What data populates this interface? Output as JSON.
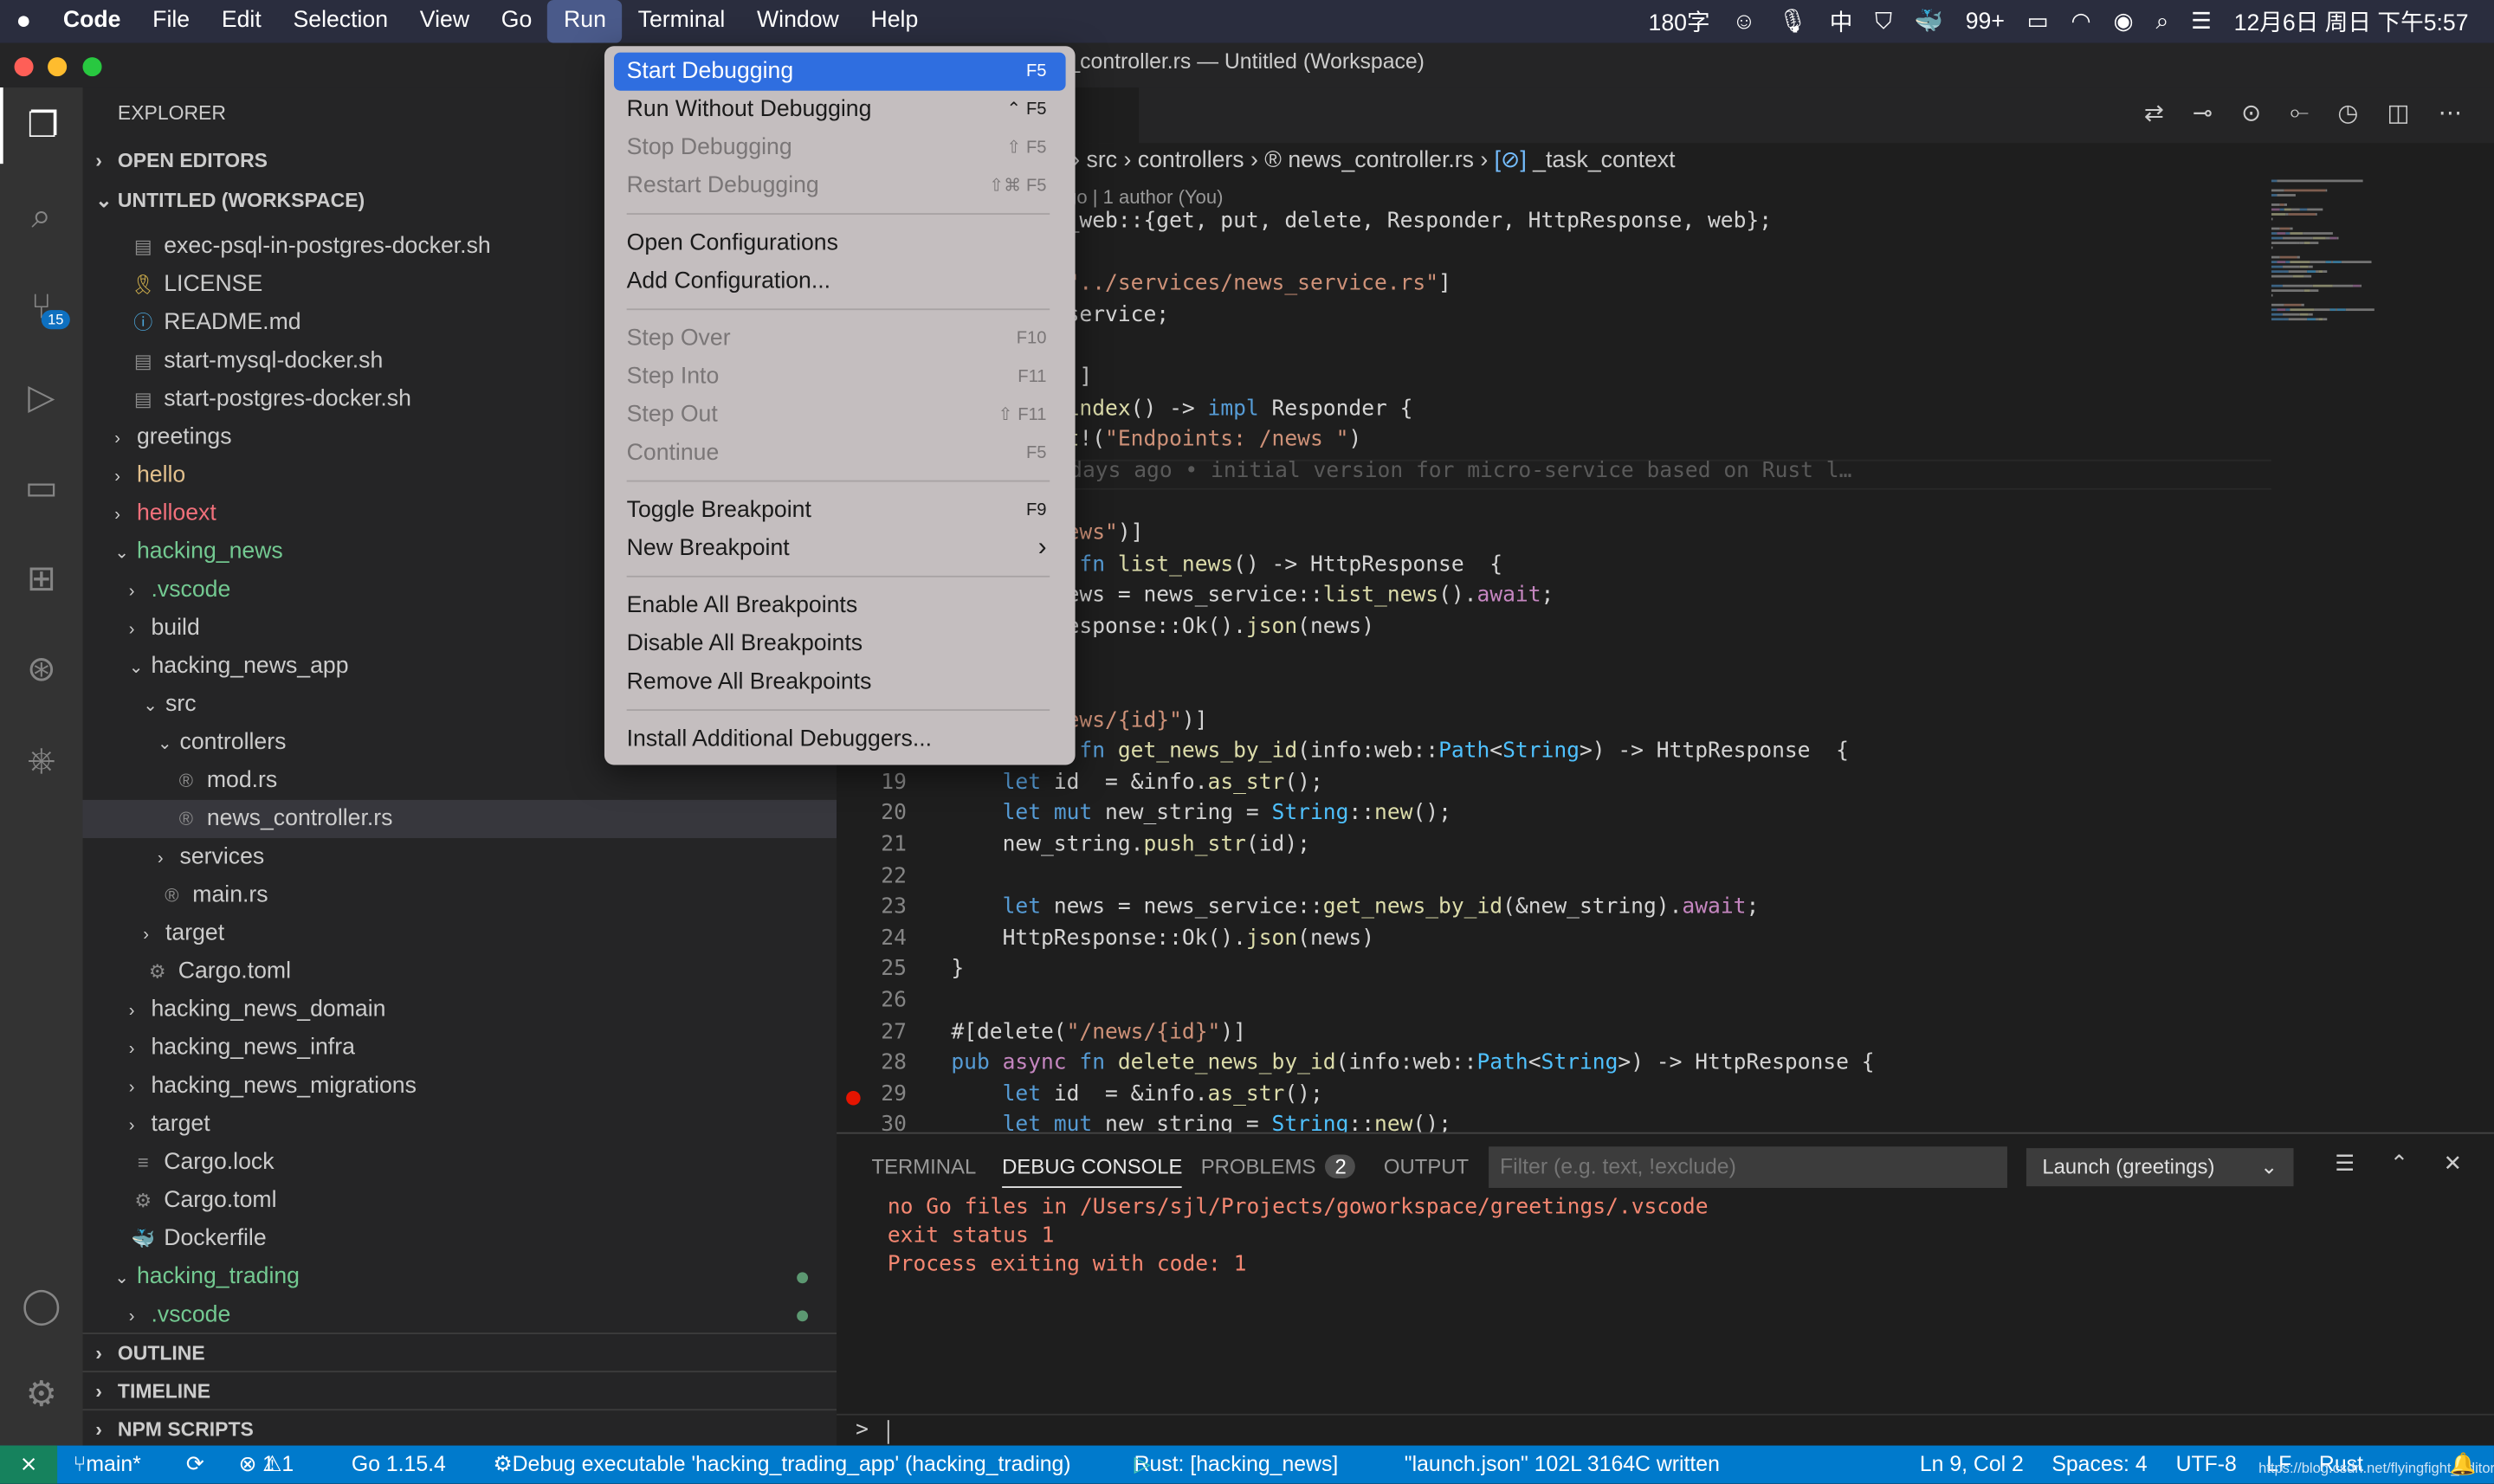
{
  "macbar": {
    "apple": "",
    "app": "Code",
    "menus": [
      "File",
      "Edit",
      "Selection",
      "View",
      "Go",
      "Run",
      "Terminal",
      "Window",
      "Help"
    ],
    "active": "Run",
    "status_items": [
      "180字",
      "☺",
      "🎙",
      "中",
      "99+"
    ],
    "datetime": "12月6日 周日 下午5:57"
  },
  "window": {
    "title": "news_controller.rs — Untitled (Workspace)"
  },
  "activity": {
    "items": [
      {
        "icon": "files-icon"
      },
      {
        "icon": "search-icon"
      },
      {
        "icon": "source-control-icon",
        "badge": "15"
      },
      {
        "icon": "run-debug-icon"
      },
      {
        "icon": "remote-explorer-icon"
      },
      {
        "icon": "extensions-icon"
      },
      {
        "icon": "git-graph-icon"
      },
      {
        "icon": "kubernetes-icon"
      }
    ],
    "bottom": [
      {
        "icon": "account-icon"
      },
      {
        "icon": "gear-icon"
      }
    ]
  },
  "sidebar": {
    "title": "EXPLORER",
    "open_editors": "OPEN EDITORS",
    "workspace": "UNTITLED (WORKSPACE)",
    "outline": "OUTLINE",
    "timeline": "TIMELINE",
    "npm": "NPM SCRIPTS",
    "tree": [
      {
        "label": "exec-psql-in-postgres-docker.sh",
        "depth": 1,
        "type": "file",
        "icon": "▤",
        "iconColor": "#8a8a8a"
      },
      {
        "label": "LICENSE",
        "depth": 1,
        "type": "file",
        "icon": "🎗",
        "iconColor": "#d4b24c"
      },
      {
        "label": "README.md",
        "depth": 1,
        "type": "file",
        "icon": "ⓘ",
        "iconColor": "#4ba5d9"
      },
      {
        "label": "start-mysql-docker.sh",
        "depth": 1,
        "type": "file",
        "icon": "▤",
        "iconColor": "#8a8a8a"
      },
      {
        "label": "start-postgres-docker.sh",
        "depth": 1,
        "type": "file",
        "icon": "▤",
        "iconColor": "#8a8a8a"
      },
      {
        "label": "greetings",
        "depth": 0,
        "type": "folder",
        "open": false
      },
      {
        "label": "hello",
        "depth": 0,
        "type": "folder",
        "open": false,
        "color": "#e2c08d"
      },
      {
        "label": "helloext",
        "depth": 0,
        "type": "folder",
        "open": false,
        "color": "#f1707b"
      },
      {
        "label": "hacking_news",
        "depth": 0,
        "type": "folder",
        "open": true,
        "color": "#73c991"
      },
      {
        "label": ".vscode",
        "depth": 1,
        "type": "folder",
        "open": false,
        "color": "#73c991"
      },
      {
        "label": "build",
        "depth": 1,
        "type": "folder",
        "open": false
      },
      {
        "label": "hacking_news_app",
        "depth": 1,
        "type": "folder",
        "open": true
      },
      {
        "label": "src",
        "depth": 2,
        "type": "folder",
        "open": true
      },
      {
        "label": "controllers",
        "depth": 3,
        "type": "folder",
        "open": true
      },
      {
        "label": "mod.rs",
        "depth": 4,
        "type": "file",
        "icon": "®",
        "iconColor": "#8a8a8a"
      },
      {
        "label": "news_controller.rs",
        "depth": 4,
        "type": "file",
        "icon": "®",
        "iconColor": "#8a8a8a",
        "selected": true
      },
      {
        "label": "services",
        "depth": 3,
        "type": "folder",
        "open": false
      },
      {
        "label": "main.rs",
        "depth": 3,
        "type": "file",
        "icon": "®",
        "iconColor": "#8a8a8a"
      },
      {
        "label": "target",
        "depth": 2,
        "type": "folder",
        "open": false
      },
      {
        "label": "Cargo.toml",
        "depth": 2,
        "type": "file",
        "icon": "⚙",
        "iconColor": "#8a8a8a"
      },
      {
        "label": "hacking_news_domain",
        "depth": 1,
        "type": "folder",
        "open": false
      },
      {
        "label": "hacking_news_infra",
        "depth": 1,
        "type": "folder",
        "open": false
      },
      {
        "label": "hacking_news_migrations",
        "depth": 1,
        "type": "folder",
        "open": false
      },
      {
        "label": "target",
        "depth": 1,
        "type": "folder",
        "open": false
      },
      {
        "label": "Cargo.lock",
        "depth": 1,
        "type": "file",
        "icon": "≡",
        "iconColor": "#8a8a8a"
      },
      {
        "label": "Cargo.toml",
        "depth": 1,
        "type": "file",
        "icon": "⚙",
        "iconColor": "#8a8a8a"
      },
      {
        "label": "Dockerfile",
        "depth": 1,
        "type": "file",
        "icon": "🐳",
        "iconColor": "#3a94d6"
      },
      {
        "label": "hacking_trading",
        "depth": 0,
        "type": "folder",
        "open": true,
        "color": "#73c991",
        "dot": true
      },
      {
        "label": ".vscode",
        "depth": 1,
        "type": "folder",
        "open": false,
        "color": "#73c991",
        "dot": true
      }
    ]
  },
  "editor": {
    "breadcrumb": [
      "hacking_news",
      "hacking_news_app",
      "src",
      "controllers",
      "news_controller.rs",
      "_task_context"
    ],
    "blame_header": "You, 6 days ago | 1 author (You)",
    "inline_blame": "You, 6 days ago • initial version for micro-service based on Rust l…",
    "current_line": 9,
    "breakpoint_line": 29,
    "lines": [
      [
        [
          "use ",
          "kw"
        ],
        [
          "actix_web::{get, put, delete, Responder, HttpResponse, web};",
          "tx"
        ]
      ],
      [],
      [
        [
          "#[path = ",
          "tx"
        ],
        [
          "\"../services/news_service.rs\"",
          "st"
        ],
        [
          "]",
          "tx"
        ]
      ],
      [
        [
          "mod ",
          "kw"
        ],
        [
          "news_service;",
          "tx"
        ]
      ],
      [],
      [
        [
          "#[get(",
          "tx"
        ],
        [
          "\"/\"",
          "st"
        ],
        [
          ")]",
          "tx"
        ]
      ],
      [
        [
          "async ",
          "aw"
        ],
        [
          "fn ",
          "kw"
        ],
        [
          "index",
          "fn"
        ],
        [
          "() -> ",
          "tx"
        ],
        [
          "impl ",
          "kw"
        ],
        [
          "Responder {",
          "tx"
        ]
      ],
      [
        [
          "    format",
          "fn"
        ],
        [
          "!(",
          "tx"
        ],
        [
          "\"Endpoints: /news \"",
          "st"
        ],
        [
          ")",
          "tx"
        ]
      ],
      [
        [
          "}",
          "tx"
        ]
      ],
      [],
      [
        [
          "#[get(",
          "tx"
        ],
        [
          "\"/news\"",
          "st"
        ],
        [
          ")]",
          "tx"
        ]
      ],
      [
        [
          "pub ",
          "kw"
        ],
        [
          "async ",
          "aw"
        ],
        [
          "fn ",
          "kw"
        ],
        [
          "list_news",
          "fn"
        ],
        [
          "() -> HttpResponse  {",
          "tx"
        ]
      ],
      [
        [
          "    let ",
          "kw"
        ],
        [
          "news = news_service::",
          "tx"
        ],
        [
          "list_news",
          "fn"
        ],
        [
          "().",
          "tx"
        ],
        [
          "await",
          "aw"
        ],
        [
          ";",
          "tx"
        ]
      ],
      [
        [
          "    HttpResponse::",
          "tx"
        ],
        [
          "Ok",
          "tx"
        ],
        [
          "().",
          "tx"
        ],
        [
          "json",
          "fn"
        ],
        [
          "(news)",
          "tx"
        ]
      ],
      [
        [
          "}",
          "tx"
        ]
      ],
      [],
      [
        [
          "#[get(",
          "tx"
        ],
        [
          "\"/news/{id}\"",
          "st"
        ],
        [
          ")]",
          "tx"
        ]
      ],
      [
        [
          "pub ",
          "kw"
        ],
        [
          "async ",
          "aw"
        ],
        [
          "fn ",
          "kw"
        ],
        [
          "get_news_by_id",
          "fn"
        ],
        [
          "(info:web::",
          "tx"
        ],
        [
          "Path",
          "tyb"
        ],
        [
          "<",
          "tx"
        ],
        [
          "String",
          "tyb"
        ],
        [
          ">) -> HttpResponse  {",
          "tx"
        ]
      ],
      [
        [
          "    let ",
          "kw"
        ],
        [
          "id  = &info.",
          "tx"
        ],
        [
          "as_str",
          "fn"
        ],
        [
          "();",
          "tx"
        ]
      ],
      [
        [
          "    let ",
          "kw"
        ],
        [
          "mut ",
          "kw"
        ],
        [
          "new_string = ",
          "tx"
        ],
        [
          "String",
          "tyb"
        ],
        [
          "::",
          "tx"
        ],
        [
          "new",
          "fn"
        ],
        [
          "();",
          "tx"
        ]
      ],
      [
        [
          "    new_string.",
          "tx"
        ],
        [
          "push_str",
          "fn"
        ],
        [
          "(id);",
          "tx"
        ]
      ],
      [],
      [
        [
          "    let ",
          "kw"
        ],
        [
          "news = news_service::",
          "tx"
        ],
        [
          "get_news_by_id",
          "fn"
        ],
        [
          "(&new_string).",
          "tx"
        ],
        [
          "await",
          "aw"
        ],
        [
          ";",
          "tx"
        ]
      ],
      [
        [
          "    HttpResponse::Ok().",
          "tx"
        ],
        [
          "json",
          "fn"
        ],
        [
          "(news)",
          "tx"
        ]
      ],
      [
        [
          "}",
          "tx"
        ]
      ],
      [],
      [
        [
          "#[delete(",
          "tx"
        ],
        [
          "\"/news/{id}\"",
          "st"
        ],
        [
          ")]",
          "tx"
        ]
      ],
      [
        [
          "pub ",
          "kw"
        ],
        [
          "async ",
          "aw"
        ],
        [
          "fn ",
          "kw"
        ],
        [
          "delete_news_by_id",
          "fn"
        ],
        [
          "(info:web::",
          "tx"
        ],
        [
          "Path",
          "tyb"
        ],
        [
          "<",
          "tx"
        ],
        [
          "String",
          "tyb"
        ],
        [
          ">) -> HttpResponse {",
          "tx"
        ]
      ],
      [
        [
          "    let ",
          "kw"
        ],
        [
          "id  = &info.",
          "tx"
        ],
        [
          "as_str",
          "fn"
        ],
        [
          "();",
          "tx"
        ]
      ],
      [
        [
          "    let ",
          "kw"
        ],
        [
          "mut ",
          "kw"
        ],
        [
          "new_string = ",
          "tx"
        ],
        [
          "String",
          "tyb"
        ],
        [
          "::",
          "tx"
        ],
        [
          "new",
          "fn"
        ],
        [
          "();",
          "tx"
        ]
      ]
    ]
  },
  "run_menu": {
    "items": [
      {
        "label": "Start Debugging",
        "shortcut": "F5",
        "highlight": true
      },
      {
        "label": "Run Without Debugging",
        "shortcut": "⌃ F5"
      },
      {
        "label": "Stop Debugging",
        "shortcut": "⇧ F5",
        "disabled": true
      },
      {
        "label": "Restart Debugging",
        "shortcut": "⇧⌘ F5",
        "disabled": true
      },
      {
        "sep": true
      },
      {
        "label": "Open Configurations",
        "shortcut": ""
      },
      {
        "label": "Add Configuration...",
        "shortcut": ""
      },
      {
        "sep": true
      },
      {
        "label": "Step Over",
        "shortcut": "F10",
        "disabled": true
      },
      {
        "label": "Step Into",
        "shortcut": "F11",
        "disabled": true
      },
      {
        "label": "Step Out",
        "shortcut": "⇧ F11",
        "disabled": true
      },
      {
        "label": "Continue",
        "shortcut": "F5",
        "disabled": true
      },
      {
        "sep": true
      },
      {
        "label": "Toggle Breakpoint",
        "shortcut": "F9"
      },
      {
        "label": "New Breakpoint",
        "shortcut": "›"
      },
      {
        "sep": true
      },
      {
        "label": "Enable All Breakpoints",
        "shortcut": ""
      },
      {
        "label": "Disable All Breakpoints",
        "shortcut": ""
      },
      {
        "label": "Remove All Breakpoints",
        "shortcut": ""
      },
      {
        "sep": true
      },
      {
        "label": "Install Additional Debuggers...",
        "shortcut": ""
      }
    ]
  },
  "panel": {
    "tabs": [
      "TERMINAL",
      "DEBUG CONSOLE",
      "PROBLEMS",
      "OUTPUT"
    ],
    "active": "DEBUG CONSOLE",
    "problems_count": "2",
    "filter_placeholder": "Filter (e.g. text, !exclude)",
    "launch": "Launch (greetings)",
    "output": [
      "no Go files in /Users/sjl/Projects/goworkspace/greetings/.vscode",
      "exit status 1",
      "Process exiting with code: 1"
    ],
    "prompt": ">"
  },
  "statusbar": {
    "remote": "⨯",
    "branch": "main*",
    "errors": "1",
    "warnings": "1",
    "go": "Go 1.15.4",
    "debug": "Debug executable 'hacking_trading_app' (hacking_trading)",
    "rust": "Rust: [hacking_news]",
    "message": "\"launch.json\" 102L 3164C written",
    "position": "Ln 9, Col 2",
    "spaces": "Spaces: 4",
    "encoding": "UTF-8",
    "eol": "LF",
    "language": "Rust",
    "watermark": "https://blog.csdn.net/flyingfight_editor",
    "colors": {
      "bg": "#007acc"
    }
  }
}
